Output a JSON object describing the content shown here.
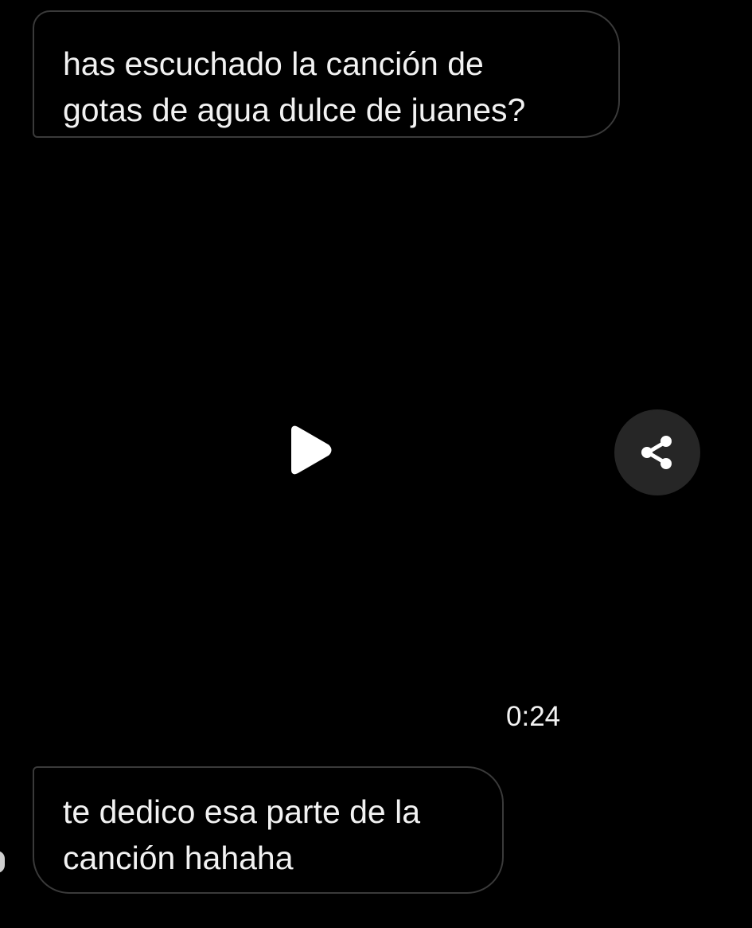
{
  "messages": [
    {
      "lines": [
        "has escuchado la canción de",
        "gotas de agua dulce de juanes?"
      ]
    },
    {
      "lines": [
        "te dedico esa parte de la",
        "canción hahaha"
      ]
    }
  ],
  "video": {
    "play_icon": "play-icon",
    "share_icon": "share-icon",
    "duration": "0:24"
  },
  "colors": {
    "background": "#000000",
    "bubble_border": "#3a3a3a",
    "text": "#f2f2f2",
    "share_button_bg": "#262626"
  }
}
